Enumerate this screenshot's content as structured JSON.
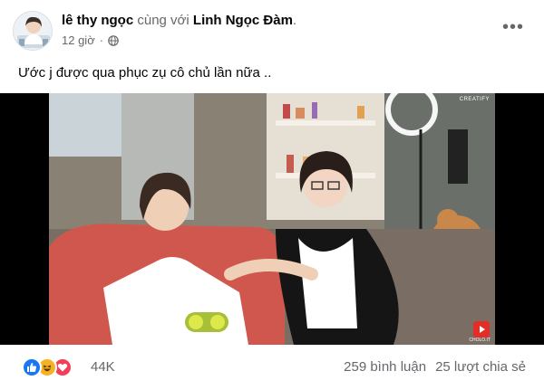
{
  "post": {
    "author": "lê thy ngọc",
    "with_text": "cùng với",
    "tagged": "Linh Ngọc Đàm",
    "time": "12 giờ",
    "privacy_icon": "globe-icon",
    "more_icon": "more-horizontal-icon",
    "more_glyph": "•••",
    "caption": "Ước j được qua phục zụ cô chủ lần nữa .."
  },
  "media": {
    "watermark": "CREATIFY",
    "channel_logo_label": "CHOLO.IT"
  },
  "stats": {
    "reaction_icons": [
      "like-icon",
      "haha-icon",
      "love-icon"
    ],
    "reaction_count": "44K",
    "comments": "259 bình luận",
    "shares": "25 lượt chia sẻ"
  },
  "colors": {
    "like": "#1877f2",
    "haha": "#f7b125",
    "love": "#f33e58",
    "secondary_text": "#65676b"
  }
}
